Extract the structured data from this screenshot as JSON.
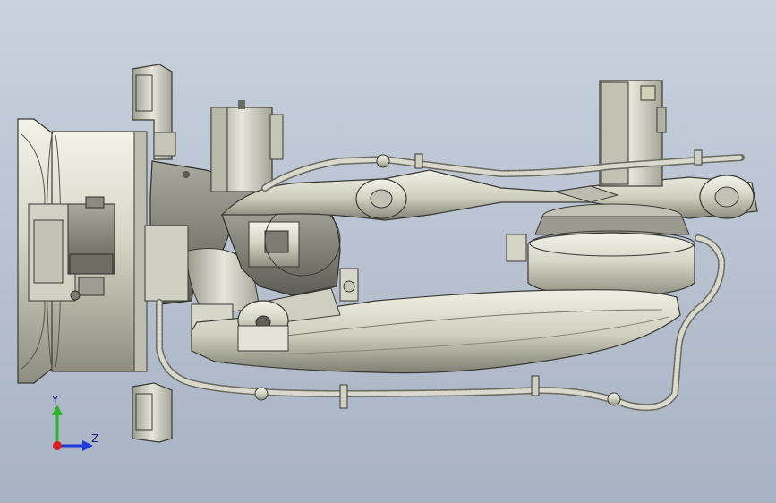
{
  "viewport": {
    "background_top": "#c9d2de",
    "background_bottom": "#a7b2c3",
    "model_color": "#d8d8c9",
    "edge_color": "#3a3a34"
  },
  "triad": {
    "y_label": "Y",
    "z_label": "Z",
    "y_color": "#2bb52b",
    "z_color": "#1f3bd9",
    "x_color": "#d92020"
  }
}
